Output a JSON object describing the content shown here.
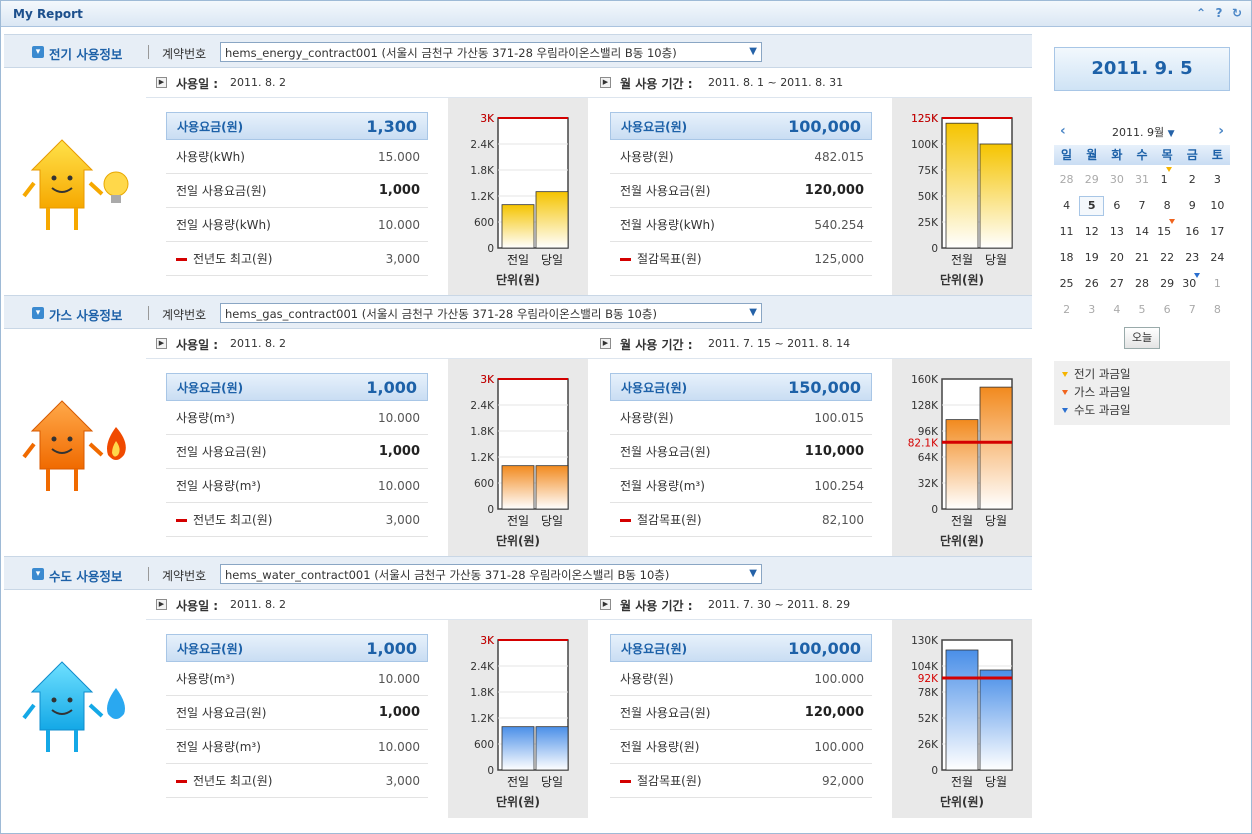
{
  "app_title": "My Report",
  "toolbar_icons": [
    "collapse-icon",
    "help-icon",
    "refresh-icon"
  ],
  "sections": [
    {
      "key": "elec",
      "title": "전기 사용정보",
      "contract_label": "계약번호",
      "contract_value": "hems_energy_contract001 (서울시 금천구 가산동 371-28 우림라이온스밸리 B동 10층)",
      "icon": "electric-house-icon",
      "daily": {
        "label": "사용일 :",
        "date": "2011. 8. 2",
        "fee_label": "사용요금(원)",
        "fee_value": "1,300",
        "rows": [
          {
            "label": "사용량(kWh)",
            "value": "15.000",
            "bold": false
          },
          {
            "label": "전일 사용요금(원)",
            "value": "1,000",
            "bold": true
          },
          {
            "label": "전일 사용량(kWh)",
            "value": "10.000",
            "bold": false
          },
          {
            "label": "전년도 최고(원)",
            "value": "3,000",
            "bold": false,
            "red": true
          }
        ]
      },
      "monthly": {
        "label": "월 사용 기간 :",
        "date": "2011. 8. 1 ~ 2011. 8. 31",
        "fee_label": "사용요금(원)",
        "fee_value": "100,000",
        "rows": [
          {
            "label": "사용량(원)",
            "value": "482.015",
            "bold": false
          },
          {
            "label": "전월 사용요금(원)",
            "value": "120,000",
            "bold": true
          },
          {
            "label": "전월 사용량(kWh)",
            "value": "540.254",
            "bold": false
          },
          {
            "label": "절감목표(원)",
            "value": "125,000",
            "bold": false,
            "red": true
          }
        ]
      }
    },
    {
      "key": "gas",
      "title": "가스 사용정보",
      "contract_label": "계약번호",
      "contract_value": "hems_gas_contract001 (서울시 금천구 가산동 371-28 우림라이온스밸리 B동 10층)",
      "icon": "gas-house-icon",
      "daily": {
        "label": "사용일 :",
        "date": "2011. 8. 2",
        "fee_label": "사용요금(원)",
        "fee_value": "1,000",
        "rows": [
          {
            "label": "사용량(m³)",
            "value": "10.000",
            "bold": false
          },
          {
            "label": "전일 사용요금(원)",
            "value": "1,000",
            "bold": true
          },
          {
            "label": "전일 사용량(m³)",
            "value": "10.000",
            "bold": false
          },
          {
            "label": "전년도 최고(원)",
            "value": "3,000",
            "bold": false,
            "red": true
          }
        ]
      },
      "monthly": {
        "label": "월 사용 기간 :",
        "date": "2011. 7. 15 ~ 2011. 8. 14",
        "fee_label": "사용요금(원)",
        "fee_value": "150,000",
        "rows": [
          {
            "label": "사용량(원)",
            "value": "100.015",
            "bold": false
          },
          {
            "label": "전월 사용요금(원)",
            "value": "110,000",
            "bold": true
          },
          {
            "label": "전월 사용량(m³)",
            "value": "100.254",
            "bold": false
          },
          {
            "label": "절감목표(원)",
            "value": "82,100",
            "bold": false,
            "red": true
          }
        ]
      }
    },
    {
      "key": "water",
      "title": "수도 사용정보",
      "contract_label": "계약번호",
      "contract_value": "hems_water_contract001 (서울시 금천구 가산동 371-28 우림라이온스밸리 B동 10층)",
      "icon": "water-house-icon",
      "daily": {
        "label": "사용일 :",
        "date": "2011. 8. 2",
        "fee_label": "사용요금(원)",
        "fee_value": "1,000",
        "rows": [
          {
            "label": "사용량(m³)",
            "value": "10.000",
            "bold": false
          },
          {
            "label": "전일 사용요금(원)",
            "value": "1,000",
            "bold": true
          },
          {
            "label": "전일 사용량(m³)",
            "value": "10.000",
            "bold": false
          },
          {
            "label": "전년도 최고(원)",
            "value": "3,000",
            "bold": false,
            "red": true
          }
        ]
      },
      "monthly": {
        "label": "월 사용 기간 :",
        "date": "2011. 7. 30 ~ 2011. 8. 29",
        "fee_label": "사용요금(원)",
        "fee_value": "100,000",
        "rows": [
          {
            "label": "사용량(원)",
            "value": "100.000",
            "bold": false
          },
          {
            "label": "전월 사용요금(원)",
            "value": "120,000",
            "bold": true
          },
          {
            "label": "전월 사용량(원)",
            "value": "100.000",
            "bold": false
          },
          {
            "label": "절감목표(원)",
            "value": "92,000",
            "bold": false,
            "red": true
          }
        ]
      }
    }
  ],
  "chart_data": [
    {
      "id": "elec-daily",
      "type": "bar",
      "categories": [
        "전일",
        "당일"
      ],
      "values": [
        1000,
        1300
      ],
      "ylim": [
        0,
        3000
      ],
      "yticks": [
        "0",
        "600",
        "1.2K",
        "1.8K",
        "2.4K",
        "3K"
      ],
      "ref_value": 3000,
      "ref_label": "3K",
      "xlabel": "단위(원)",
      "color": "#f5c400"
    },
    {
      "id": "elec-monthly",
      "type": "bar",
      "categories": [
        "전월",
        "당월"
      ],
      "values": [
        120000,
        100000
      ],
      "ylim": [
        0,
        125000
      ],
      "yticks": [
        "0",
        "25K",
        "50K",
        "75K",
        "100K",
        "125K"
      ],
      "ref_value": 125000,
      "ref_label": "125K",
      "xlabel": "단위(원)",
      "color": "#f5c400"
    },
    {
      "id": "gas-daily",
      "type": "bar",
      "categories": [
        "전일",
        "당일"
      ],
      "values": [
        1000,
        1000
      ],
      "ylim": [
        0,
        3000
      ],
      "yticks": [
        "0",
        "600",
        "1.2K",
        "1.8K",
        "2.4K",
        "3K"
      ],
      "ref_value": 3000,
      "ref_label": "3K",
      "xlabel": "단위(원)",
      "color": "#f28a1e"
    },
    {
      "id": "gas-monthly",
      "type": "bar",
      "categories": [
        "전월",
        "당월"
      ],
      "values": [
        110000,
        150000
      ],
      "ylim": [
        0,
        160000
      ],
      "yticks": [
        "0",
        "32K",
        "64K",
        "96K",
        "128K",
        "160K"
      ],
      "ref_value": 82100,
      "ref_label": "82.1K",
      "xlabel": "단위(원)",
      "color": "#f28a1e"
    },
    {
      "id": "water-daily",
      "type": "bar",
      "categories": [
        "전일",
        "당일"
      ],
      "values": [
        1000,
        1000
      ],
      "ylim": [
        0,
        3000
      ],
      "yticks": [
        "0",
        "600",
        "1.2K",
        "1.8K",
        "2.4K",
        "3K"
      ],
      "ref_value": 3000,
      "ref_label": "3K",
      "xlabel": "단위(원)",
      "color": "#4a8fe8"
    },
    {
      "id": "water-monthly",
      "type": "bar",
      "categories": [
        "전월",
        "당월"
      ],
      "values": [
        120000,
        100000
      ],
      "ylim": [
        0,
        130000
      ],
      "yticks": [
        "0",
        "26K",
        "52K",
        "78K",
        "104K",
        "130K"
      ],
      "ref_value": 92000,
      "ref_label": "92K",
      "xlabel": "단위(원)",
      "color": "#4a8fe8"
    }
  ],
  "calendar": {
    "date_display": "2011. 9. 5",
    "month_label": "2011. 9월",
    "weekdays": [
      "일",
      "월",
      "화",
      "수",
      "목",
      "금",
      "토"
    ],
    "days": [
      {
        "d": "28",
        "o": true
      },
      {
        "d": "29",
        "o": true
      },
      {
        "d": "30",
        "o": true
      },
      {
        "d": "31",
        "o": true
      },
      {
        "d": "1",
        "m": "elec"
      },
      {
        "d": "2"
      },
      {
        "d": "3"
      },
      {
        "d": "4"
      },
      {
        "d": "5",
        "today": true
      },
      {
        "d": "6"
      },
      {
        "d": "7"
      },
      {
        "d": "8"
      },
      {
        "d": "9"
      },
      {
        "d": "10"
      },
      {
        "d": "11"
      },
      {
        "d": "12"
      },
      {
        "d": "13"
      },
      {
        "d": "14"
      },
      {
        "d": "15",
        "m": "gas"
      },
      {
        "d": "16"
      },
      {
        "d": "17"
      },
      {
        "d": "18"
      },
      {
        "d": "19"
      },
      {
        "d": "20"
      },
      {
        "d": "21"
      },
      {
        "d": "22"
      },
      {
        "d": "23"
      },
      {
        "d": "24"
      },
      {
        "d": "25"
      },
      {
        "d": "26"
      },
      {
        "d": "27"
      },
      {
        "d": "28"
      },
      {
        "d": "29"
      },
      {
        "d": "30",
        "m": "water"
      },
      {
        "d": "1",
        "o": true
      },
      {
        "d": "2",
        "o": true
      },
      {
        "d": "3",
        "o": true
      },
      {
        "d": "4",
        "o": true
      },
      {
        "d": "5",
        "o": true
      },
      {
        "d": "6",
        "o": true
      },
      {
        "d": "7",
        "o": true
      },
      {
        "d": "8",
        "o": true
      }
    ],
    "today_button": "오늘",
    "legend": [
      {
        "label": "전기 과금일",
        "color": "#f5b400"
      },
      {
        "label": "가스 과금일",
        "color": "#f0641e"
      },
      {
        "label": "수도 과금일",
        "color": "#2a6fd0"
      }
    ]
  }
}
